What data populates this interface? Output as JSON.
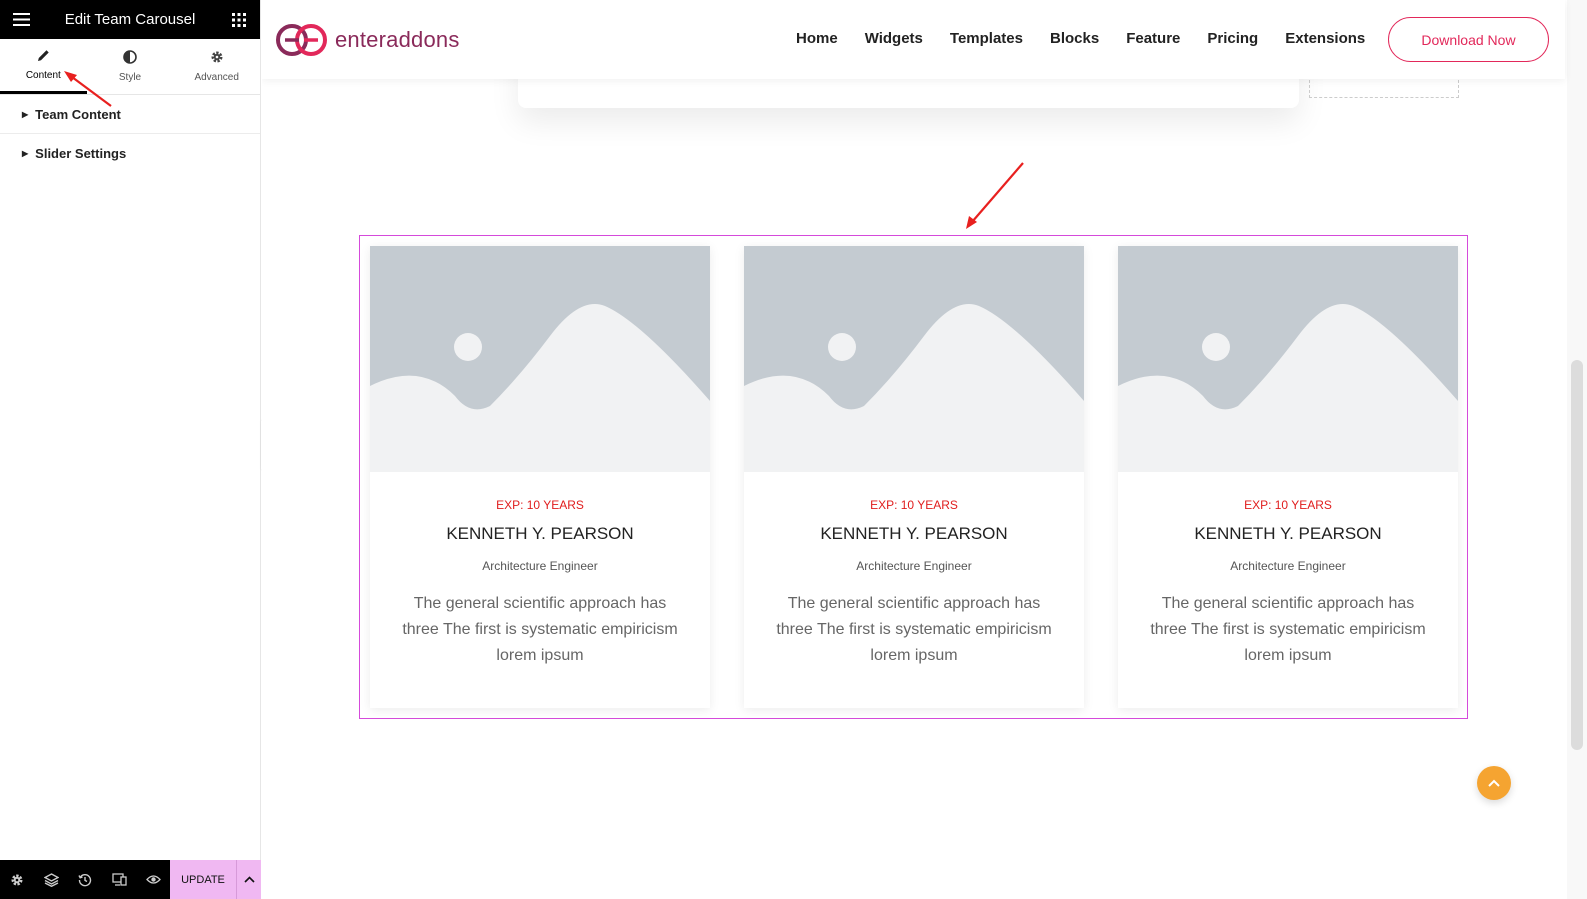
{
  "editor": {
    "title": "Edit Team Carousel",
    "tabs": [
      {
        "label": "Content",
        "icon": "pencil-icon"
      },
      {
        "label": "Style",
        "icon": "contrast-icon"
      },
      {
        "label": "Advanced",
        "icon": "gear-icon"
      }
    ],
    "sections": [
      {
        "label": "Team Content"
      },
      {
        "label": "Slider Settings"
      }
    ],
    "footer": {
      "update_label": "UPDATE",
      "icons": [
        "settings-icon",
        "layers-icon",
        "history-icon",
        "responsive-icon",
        "preview-eye-icon"
      ]
    }
  },
  "site": {
    "logo_text": "enteraddons",
    "nav": [
      "Home",
      "Widgets",
      "Templates",
      "Blocks",
      "Feature",
      "Pricing",
      "Extensions"
    ],
    "cta_label": "Download Now",
    "colors": {
      "brand": "#e2285a",
      "accent_orange": "#f5a431",
      "selection_outline": "#d54adb",
      "exp_red": "#e01d1d"
    }
  },
  "team": [
    {
      "exp": "EXP: 10 YEARS",
      "name": "KENNETH Y. PEARSON",
      "role": "Architecture Engineer",
      "desc": "The general scientific approach has three The first is systematic empiricism lorem ipsum"
    },
    {
      "exp": "EXP: 10 YEARS",
      "name": "KENNETH Y. PEARSON",
      "role": "Architecture Engineer",
      "desc": "The general scientific approach has three The first is systematic empiricism lorem ipsum"
    },
    {
      "exp": "EXP: 10 YEARS",
      "name": "KENNETH Y. PEARSON",
      "role": "Architecture Engineer",
      "desc": "The general scientific approach has three The first is systematic empiricism lorem ipsum"
    }
  ]
}
